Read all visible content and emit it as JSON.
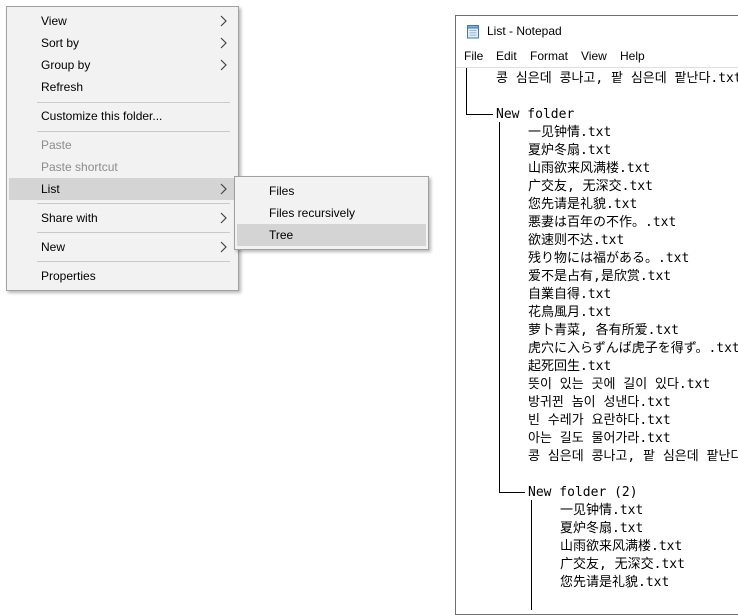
{
  "context_menu": {
    "items": [
      {
        "label": "View"
      },
      {
        "label": "Sort by"
      },
      {
        "label": "Group by"
      },
      {
        "label": "Refresh"
      },
      {
        "label": "Customize this folder..."
      },
      {
        "label": "Paste"
      },
      {
        "label": "Paste shortcut"
      },
      {
        "label": "List"
      },
      {
        "label": "Share with"
      },
      {
        "label": "New"
      },
      {
        "label": "Properties"
      }
    ]
  },
  "submenu": {
    "items": [
      {
        "label": "Files"
      },
      {
        "label": "Files recursively"
      },
      {
        "label": "Tree"
      }
    ]
  },
  "notepad": {
    "title": "List - Notepad",
    "menu": [
      "File",
      "Edit",
      "Format",
      "View",
      "Help"
    ],
    "lines": [
      "콩 심은데 콩나고, 팥 심은데 팥난다.txt",
      "New folder",
      "一见钟情.txt",
      "夏炉冬扇.txt",
      "山雨欲来风满楼.txt",
      "广交友, 无深交.txt",
      "您先请是礼貌.txt",
      "悪妻は百年の不作。.txt",
      "欲速则不达.txt",
      "残り物には福がある。.txt",
      "爱不是占有,是欣赏.txt",
      "自業自得.txt",
      "花鳥風月.txt",
      "萝卜青菜, 各有所爱.txt",
      "虎穴に入らずんば虎子を得ず。.txt",
      "起死回生.txt",
      "뜻이 있는 곳에 길이 있다.txt",
      "방귀뀐 놈이 성낸다.txt",
      "빈 수레가 요란하다.txt",
      "아는 길도 물어가라.txt",
      "콩 심은데 콩나고, 팥 심은데 팥난다.",
      "New folder (2)",
      "一见钟情.txt",
      "夏炉冬扇.txt",
      "山雨欲来风满楼.txt",
      "广交友, 无深交.txt",
      "您先请是礼貌.txt"
    ]
  }
}
